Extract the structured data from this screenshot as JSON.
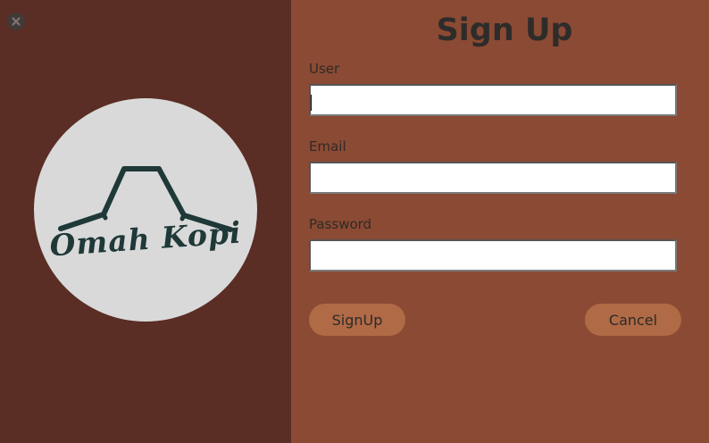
{
  "window": {
    "close_icon": "close-x-icon"
  },
  "logo": {
    "text": "Omah Kopi",
    "icon": "roof-icon",
    "circle_color": "#d9d9d9",
    "mark_color": "#1f3838"
  },
  "form": {
    "title": "Sign Up",
    "fields": [
      {
        "label": "User",
        "value": "",
        "placeholder": ""
      },
      {
        "label": "Email",
        "value": "",
        "placeholder": ""
      },
      {
        "label": "Password",
        "value": "",
        "placeholder": ""
      }
    ],
    "signup_label": "SignUp",
    "cancel_label": "Cancel"
  },
  "colors": {
    "left_panel": "#5a2d25",
    "right_panel": "#8b4a33",
    "button": "#b06a45"
  }
}
